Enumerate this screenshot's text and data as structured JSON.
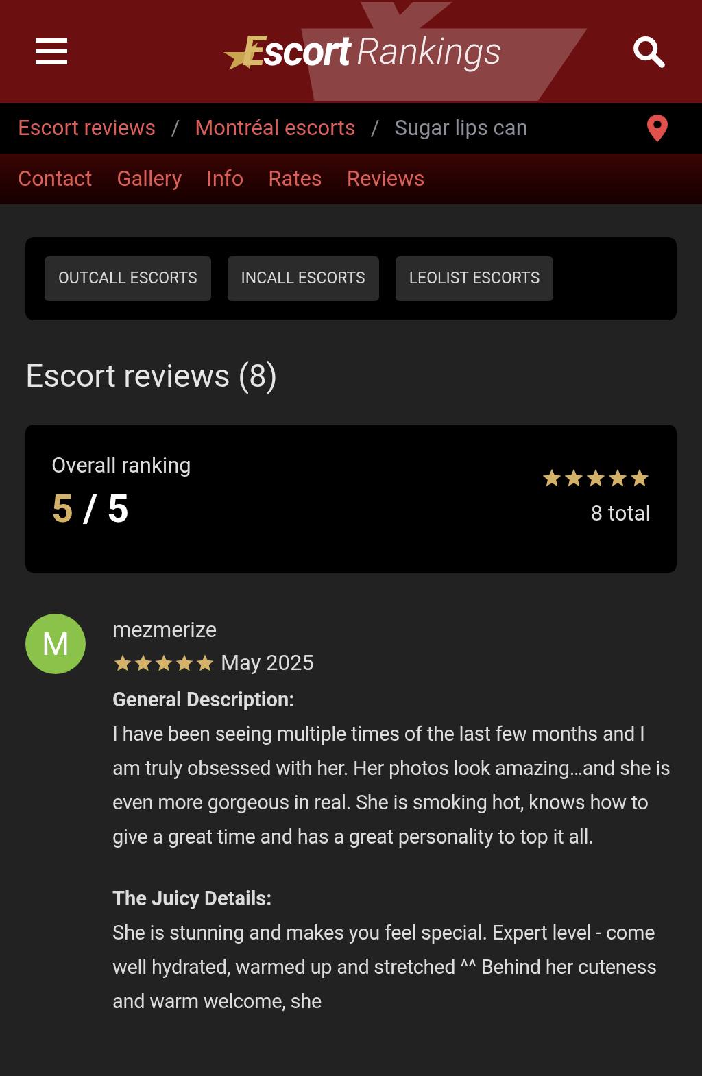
{
  "header": {
    "logo": {
      "initial": "E",
      "word": "scort",
      "tagline": "Rankings"
    }
  },
  "breadcrumbs": [
    {
      "label": "Escort reviews",
      "kind": "link"
    },
    {
      "label": "/",
      "kind": "separator"
    },
    {
      "label": "Montréal escorts",
      "kind": "link"
    },
    {
      "label": "/",
      "kind": "separator"
    },
    {
      "label": "Sugar lips can",
      "kind": "current"
    }
  ],
  "tabs": [
    "Contact",
    "Gallery",
    "Info",
    "Rates",
    "Reviews"
  ],
  "category_buttons": [
    "OUTCALL ESCORTS",
    "INCALL ESCORTS",
    "LEOLIST ESCORTS"
  ],
  "section_title": "Escort reviews (8)",
  "overall": {
    "label": "Overall ranking",
    "score": "5",
    "separator": "/",
    "max": "5",
    "stars": 5,
    "total": "8 total"
  },
  "reviews": [
    {
      "avatar_letter": "M",
      "color": "#8bc34a",
      "author": "mezmerize",
      "stars": 5,
      "date": "May 2025",
      "sections": [
        {
          "heading": "General Description:",
          "text": "I have been seeing multiple times of the last few months and I am truly obsessed with her. Her photos look amazing…and she is even more gorgeous in real. She is smoking hot, knows how to give a great time and has a great personality to top it all."
        },
        {
          "heading": "The Juicy Details:",
          "text": "She is stunning and makes you feel special. Expert level - come well hydrated, warmed up and stretched ^^ Behind her cuteness and warm welcome, she"
        }
      ]
    }
  ]
}
